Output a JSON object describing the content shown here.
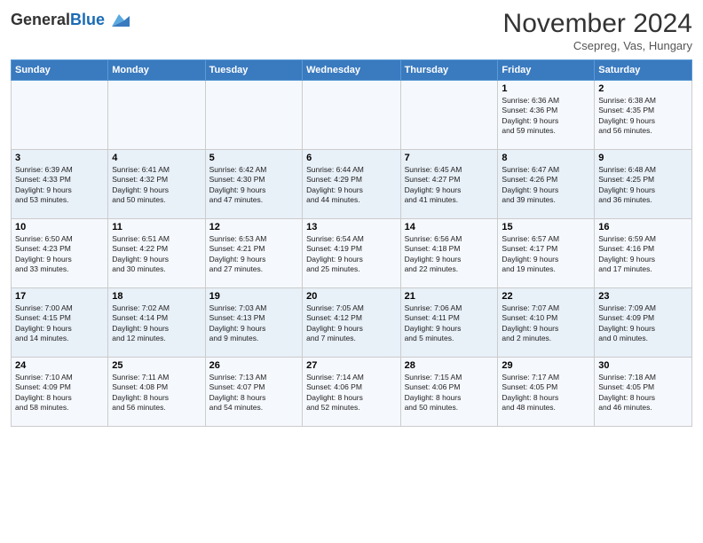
{
  "header": {
    "logo_line1": "General",
    "logo_line2": "Blue",
    "month": "November 2024",
    "location": "Csepreg, Vas, Hungary"
  },
  "weekdays": [
    "Sunday",
    "Monday",
    "Tuesday",
    "Wednesday",
    "Thursday",
    "Friday",
    "Saturday"
  ],
  "weeks": [
    [
      {
        "day": "",
        "info": ""
      },
      {
        "day": "",
        "info": ""
      },
      {
        "day": "",
        "info": ""
      },
      {
        "day": "",
        "info": ""
      },
      {
        "day": "",
        "info": ""
      },
      {
        "day": "1",
        "info": "Sunrise: 6:36 AM\nSunset: 4:36 PM\nDaylight: 9 hours\nand 59 minutes."
      },
      {
        "day": "2",
        "info": "Sunrise: 6:38 AM\nSunset: 4:35 PM\nDaylight: 9 hours\nand 56 minutes."
      }
    ],
    [
      {
        "day": "3",
        "info": "Sunrise: 6:39 AM\nSunset: 4:33 PM\nDaylight: 9 hours\nand 53 minutes."
      },
      {
        "day": "4",
        "info": "Sunrise: 6:41 AM\nSunset: 4:32 PM\nDaylight: 9 hours\nand 50 minutes."
      },
      {
        "day": "5",
        "info": "Sunrise: 6:42 AM\nSunset: 4:30 PM\nDaylight: 9 hours\nand 47 minutes."
      },
      {
        "day": "6",
        "info": "Sunrise: 6:44 AM\nSunset: 4:29 PM\nDaylight: 9 hours\nand 44 minutes."
      },
      {
        "day": "7",
        "info": "Sunrise: 6:45 AM\nSunset: 4:27 PM\nDaylight: 9 hours\nand 41 minutes."
      },
      {
        "day": "8",
        "info": "Sunrise: 6:47 AM\nSunset: 4:26 PM\nDaylight: 9 hours\nand 39 minutes."
      },
      {
        "day": "9",
        "info": "Sunrise: 6:48 AM\nSunset: 4:25 PM\nDaylight: 9 hours\nand 36 minutes."
      }
    ],
    [
      {
        "day": "10",
        "info": "Sunrise: 6:50 AM\nSunset: 4:23 PM\nDaylight: 9 hours\nand 33 minutes."
      },
      {
        "day": "11",
        "info": "Sunrise: 6:51 AM\nSunset: 4:22 PM\nDaylight: 9 hours\nand 30 minutes."
      },
      {
        "day": "12",
        "info": "Sunrise: 6:53 AM\nSunset: 4:21 PM\nDaylight: 9 hours\nand 27 minutes."
      },
      {
        "day": "13",
        "info": "Sunrise: 6:54 AM\nSunset: 4:19 PM\nDaylight: 9 hours\nand 25 minutes."
      },
      {
        "day": "14",
        "info": "Sunrise: 6:56 AM\nSunset: 4:18 PM\nDaylight: 9 hours\nand 22 minutes."
      },
      {
        "day": "15",
        "info": "Sunrise: 6:57 AM\nSunset: 4:17 PM\nDaylight: 9 hours\nand 19 minutes."
      },
      {
        "day": "16",
        "info": "Sunrise: 6:59 AM\nSunset: 4:16 PM\nDaylight: 9 hours\nand 17 minutes."
      }
    ],
    [
      {
        "day": "17",
        "info": "Sunrise: 7:00 AM\nSunset: 4:15 PM\nDaylight: 9 hours\nand 14 minutes."
      },
      {
        "day": "18",
        "info": "Sunrise: 7:02 AM\nSunset: 4:14 PM\nDaylight: 9 hours\nand 12 minutes."
      },
      {
        "day": "19",
        "info": "Sunrise: 7:03 AM\nSunset: 4:13 PM\nDaylight: 9 hours\nand 9 minutes."
      },
      {
        "day": "20",
        "info": "Sunrise: 7:05 AM\nSunset: 4:12 PM\nDaylight: 9 hours\nand 7 minutes."
      },
      {
        "day": "21",
        "info": "Sunrise: 7:06 AM\nSunset: 4:11 PM\nDaylight: 9 hours\nand 5 minutes."
      },
      {
        "day": "22",
        "info": "Sunrise: 7:07 AM\nSunset: 4:10 PM\nDaylight: 9 hours\nand 2 minutes."
      },
      {
        "day": "23",
        "info": "Sunrise: 7:09 AM\nSunset: 4:09 PM\nDaylight: 9 hours\nand 0 minutes."
      }
    ],
    [
      {
        "day": "24",
        "info": "Sunrise: 7:10 AM\nSunset: 4:09 PM\nDaylight: 8 hours\nand 58 minutes."
      },
      {
        "day": "25",
        "info": "Sunrise: 7:11 AM\nSunset: 4:08 PM\nDaylight: 8 hours\nand 56 minutes."
      },
      {
        "day": "26",
        "info": "Sunrise: 7:13 AM\nSunset: 4:07 PM\nDaylight: 8 hours\nand 54 minutes."
      },
      {
        "day": "27",
        "info": "Sunrise: 7:14 AM\nSunset: 4:06 PM\nDaylight: 8 hours\nand 52 minutes."
      },
      {
        "day": "28",
        "info": "Sunrise: 7:15 AM\nSunset: 4:06 PM\nDaylight: 8 hours\nand 50 minutes."
      },
      {
        "day": "29",
        "info": "Sunrise: 7:17 AM\nSunset: 4:05 PM\nDaylight: 8 hours\nand 48 minutes."
      },
      {
        "day": "30",
        "info": "Sunrise: 7:18 AM\nSunset: 4:05 PM\nDaylight: 8 hours\nand 46 minutes."
      }
    ]
  ]
}
